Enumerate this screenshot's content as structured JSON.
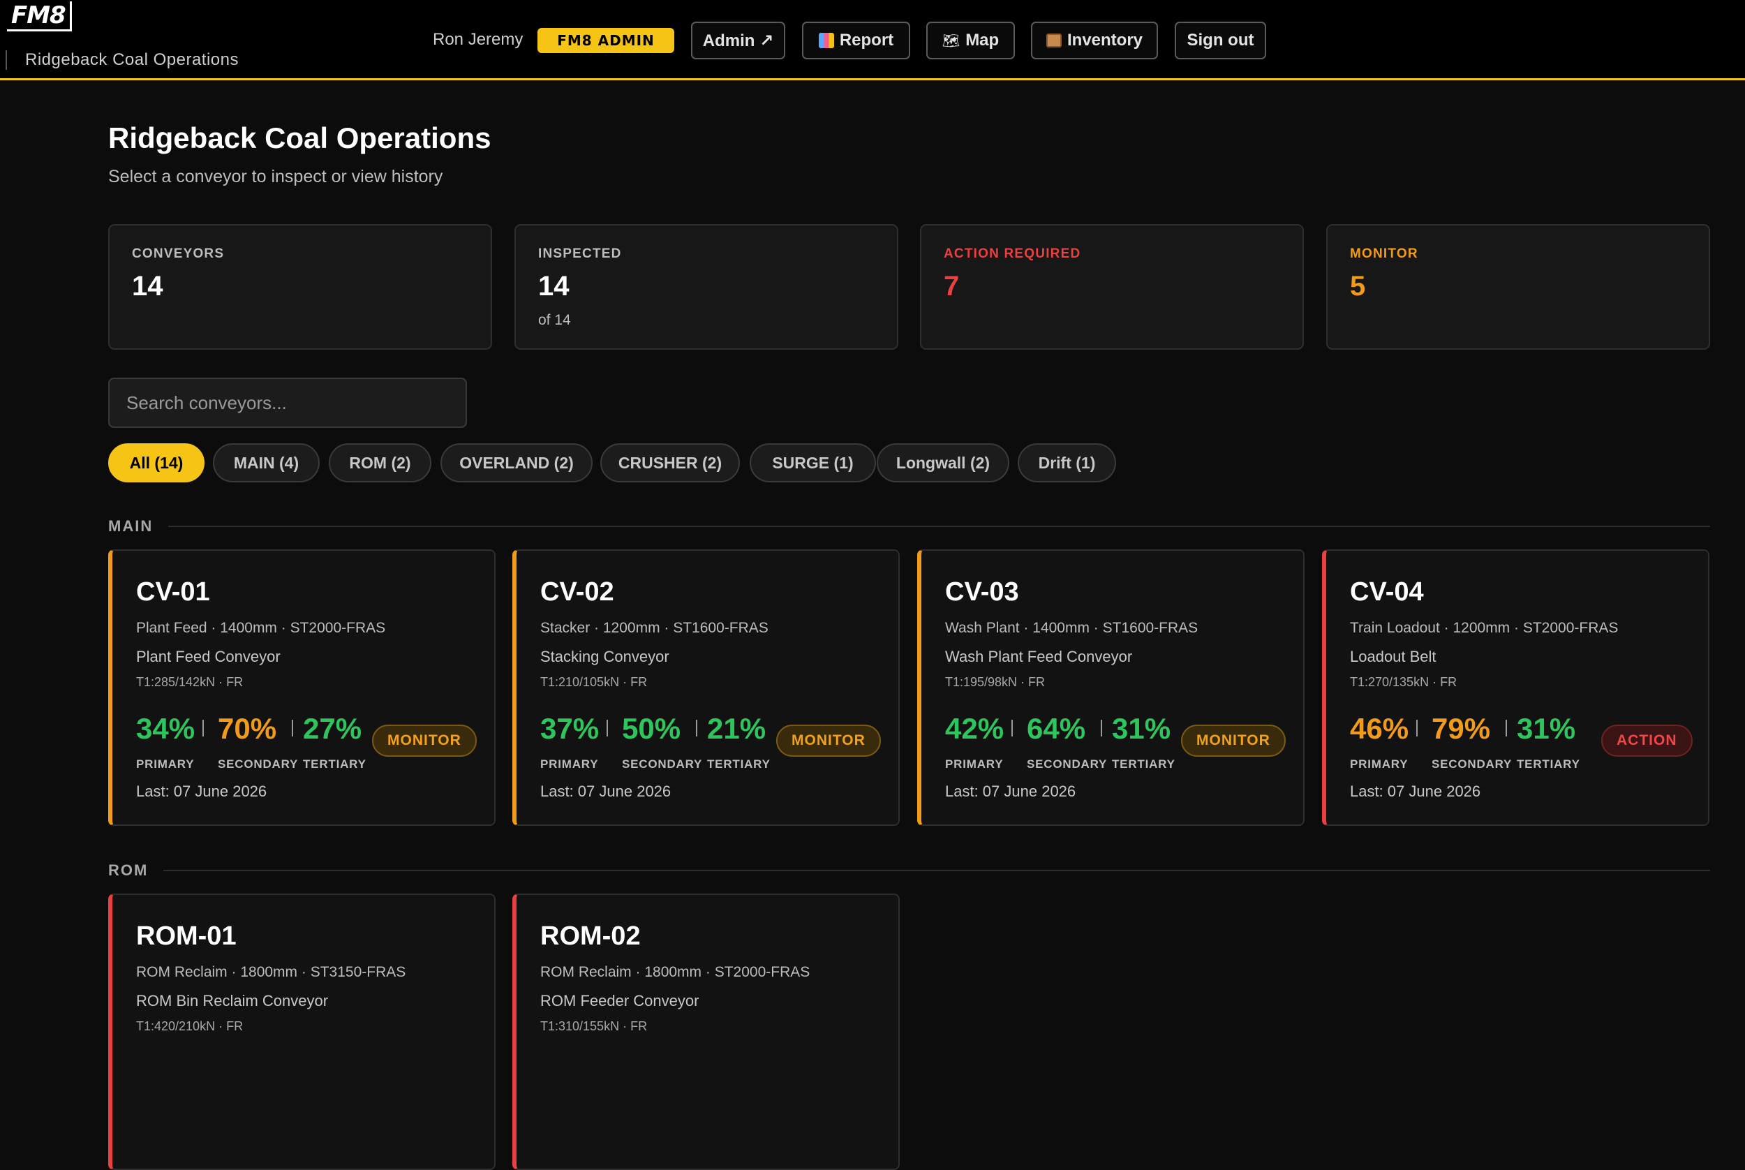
{
  "header": {
    "logo": "FM8",
    "site_name": "Ridgeback Coal Operations",
    "user_name": "Ron Jeremy",
    "admin_badge": "FM8 ADMIN",
    "nav": {
      "admin": "Admin ↗",
      "report": "Report",
      "map": "Map",
      "inventory": "Inventory",
      "signout": "Sign out"
    }
  },
  "page": {
    "title": "Ridgeback Coal Operations",
    "subtitle": "Select a conveyor to inspect or view history"
  },
  "stats": {
    "conveyors": {
      "label": "CONVEYORS",
      "value": "14"
    },
    "inspected": {
      "label": "INSPECTED",
      "value": "14",
      "sub": "of 14"
    },
    "action": {
      "label": "ACTION REQUIRED",
      "value": "7"
    },
    "monitor": {
      "label": "MONITOR",
      "value": "5"
    }
  },
  "search": {
    "placeholder": "Search conveyors..."
  },
  "filters": {
    "all": "All (14)",
    "main": "MAIN (4)",
    "rom": "ROM (2)",
    "overland": "OVERLAND (2)",
    "crusher": "CRUSHER (2)",
    "surge": "SURGE (1)",
    "longwall": "Longwall (2)",
    "drift": "Drift (1)"
  },
  "sections": {
    "main": "MAIN",
    "rom": "ROM"
  },
  "labels": {
    "primary": "PRIMARY",
    "secondary": "SECONDARY",
    "tertiary": "TERTIARY"
  },
  "cards": {
    "cv01": {
      "id": "CV-01",
      "meta": "Plant Feed · 1400mm · ST2000-FRAS",
      "desc": "Plant Feed Conveyor",
      "tension": "T1:285/142kN · FR",
      "primary": "34%",
      "secondary": "70%",
      "tertiary": "27%",
      "status": "MONITOR",
      "last": "Last: 07 June 2026"
    },
    "cv02": {
      "id": "CV-02",
      "meta": "Stacker · 1200mm · ST1600-FRAS",
      "desc": "Stacking Conveyor",
      "tension": "T1:210/105kN · FR",
      "primary": "37%",
      "secondary": "50%",
      "tertiary": "21%",
      "status": "MONITOR",
      "last": "Last: 07 June 2026"
    },
    "cv03": {
      "id": "CV-03",
      "meta": "Wash Plant · 1400mm · ST1600-FRAS",
      "desc": "Wash Plant Feed Conveyor",
      "tension": "T1:195/98kN · FR",
      "primary": "42%",
      "secondary": "64%",
      "tertiary": "31%",
      "status": "MONITOR",
      "last": "Last: 07 June 2026"
    },
    "cv04": {
      "id": "CV-04",
      "meta": "Train Loadout · 1200mm · ST2000-FRAS",
      "desc": "Loadout Belt",
      "tension": "T1:270/135kN · FR",
      "primary": "46%",
      "secondary": "79%",
      "tertiary": "31%",
      "status": "ACTION",
      "last": "Last: 07 June 2026"
    },
    "rom01": {
      "id": "ROM-01",
      "meta": "ROM Reclaim · 1800mm · ST3150-FRAS",
      "desc": "ROM Bin Reclaim Conveyor",
      "tension": "T1:420/210kN · FR"
    },
    "rom02": {
      "id": "ROM-02",
      "meta": "ROM Reclaim · 1800mm · ST2000-FRAS",
      "desc": "ROM Feeder Conveyor",
      "tension": "T1:310/155kN · FR"
    }
  },
  "colors": {
    "accent": "#f6c415",
    "green": "#2fc55d",
    "orange": "#f29b1a",
    "red": "#e94040",
    "background": "#0c0c0c",
    "card": "#121212"
  }
}
